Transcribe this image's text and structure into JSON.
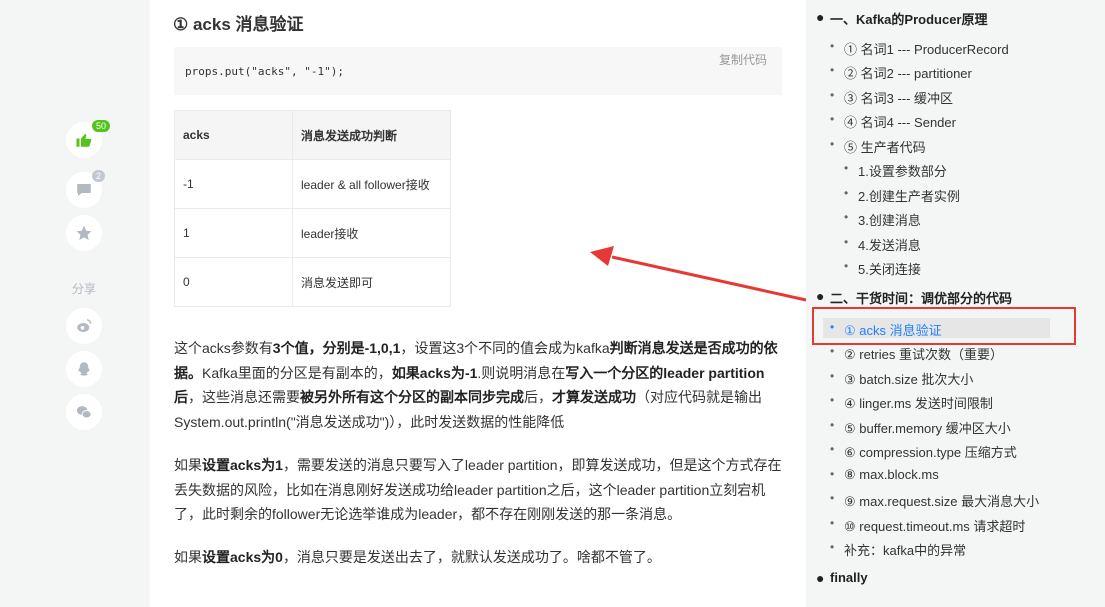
{
  "rail": {
    "like_count": "50",
    "comment_count": "2",
    "share_label": "分享",
    "like_color": "#52c41a",
    "icons": [
      "thumbs-up-icon",
      "comment-icon",
      "star-icon",
      "weibo-icon",
      "qq-icon",
      "wechat-icon"
    ]
  },
  "article": {
    "heading": "① acks 消息验证",
    "code": "props.put(\"acks\", \"-1\");",
    "copy_label": "复制代码",
    "table": {
      "headers": [
        "acks",
        "消息发送成功判断"
      ],
      "rows": [
        [
          "-1",
          "leader & all follower接收"
        ],
        [
          "1",
          "leader接收"
        ],
        [
          "0",
          "消息发送即可"
        ]
      ]
    },
    "p1": {
      "t1": "这个acks参数有",
      "b1": "3个值，分别是-1,0,1",
      "t2": "，设置这3个不同的值会成为kafka",
      "b2": "判断消息发送是否成功的依据。",
      "t3": "Kafka里面的分区是有副本的，",
      "b3": "如果acks为-1",
      "t4": ".则说明消息在",
      "b4": "写入一个分区的leader partition后",
      "t5": "，这些消息还需要",
      "b5": "被另外所有这个分区的副本同步完成",
      "t6": "后，",
      "b6": "才算发送成功",
      "t7": "（对应代码就是输出System.out.println(\"消息发送成功\")），此时发送数据的性能降低"
    },
    "p2": {
      "t1": "如果",
      "b1": "设置acks为1",
      "t2": "，需要发送的消息只要写入了leader partition，即算发送成功，但是这个方式存在丢失数据的风险，比如在消息刚好发送成功给leader partition之后，这个leader partition立刻宕机了，此时剩余的follower无论选举谁成为leader，都不存在刚刚发送的那一条消息。"
    },
    "p3": {
      "t1": "如果",
      "b1": "设置acks为0",
      "t2": "，消息只要是发送出去了，就默认发送成功了。啥都不管了。"
    }
  },
  "toc": {
    "items": [
      {
        "level": 1,
        "label": "一、Kafka的Producer原理"
      },
      {
        "level": 2,
        "label": "① 名词1 --- ProducerRecord"
      },
      {
        "level": 2,
        "label": "② 名词2 --- partitioner"
      },
      {
        "level": 2,
        "label": "③ 名词3 --- 缓冲区"
      },
      {
        "level": 2,
        "label": "④ 名词4 --- Sender"
      },
      {
        "level": 2,
        "label": "⑤ 生产者代码"
      },
      {
        "level": 3,
        "label": "1.设置参数部分"
      },
      {
        "level": 3,
        "label": "2.创建生产者实例"
      },
      {
        "level": 3,
        "label": "3.创建消息"
      },
      {
        "level": 3,
        "label": "4.发送消息"
      },
      {
        "level": 3,
        "label": "5.关闭连接"
      },
      {
        "level": 1,
        "label": "二、干货时间：调优部分的代码"
      },
      {
        "level": 2,
        "label": "① acks 消息验证",
        "active": true
      },
      {
        "level": 2,
        "label": "② retries 重试次数（重要）"
      },
      {
        "level": 2,
        "label": "③ batch.size 批次大小"
      },
      {
        "level": 2,
        "label": "④ linger.ms 发送时间限制"
      },
      {
        "level": 2,
        "label": "⑤ buffer.memory 缓冲区大小"
      },
      {
        "level": 2,
        "label": "⑥ compression.type 压缩方式"
      },
      {
        "level": 2,
        "label": "⑧ max.block.ms"
      },
      {
        "level": 2,
        "label": "⑨ max.request.size 最大消息大小"
      },
      {
        "level": 2,
        "label": "⑩ request.timeout.ms 请求超时"
      },
      {
        "level": 2,
        "label": "补充：kafka中的异常"
      },
      {
        "level": 1,
        "label": "finally"
      }
    ],
    "active_color": "#1e80ff",
    "highlight_color": "#e53935"
  }
}
